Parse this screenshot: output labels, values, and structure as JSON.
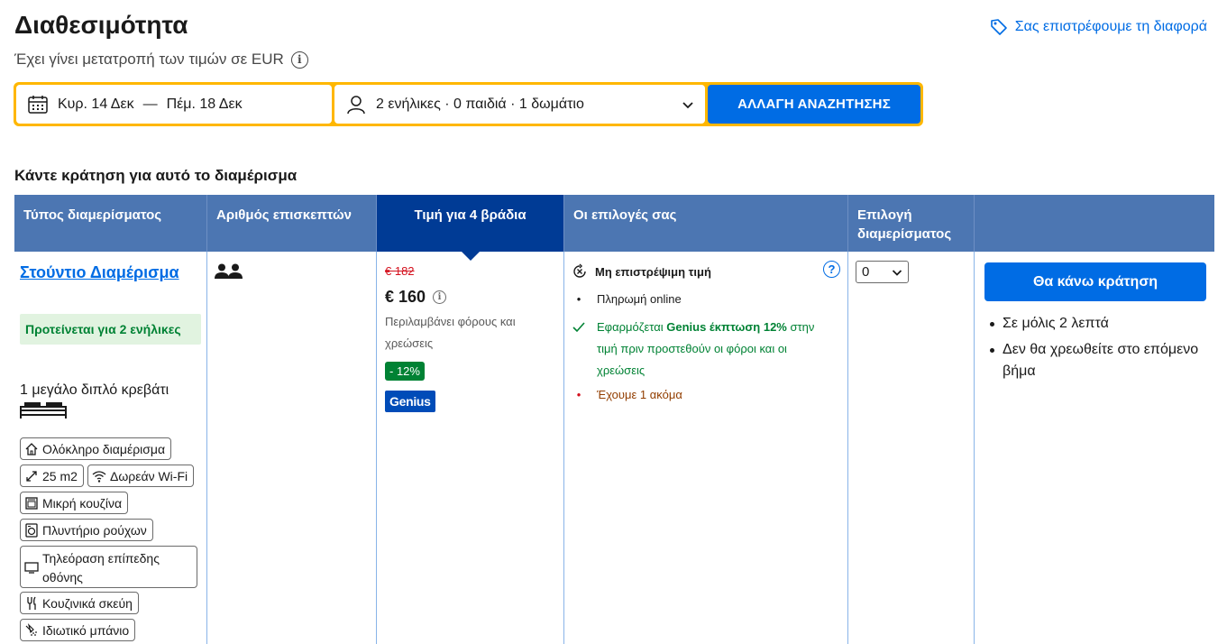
{
  "header": {
    "title": "Διαθεσιμότητα",
    "subtitle": "Έχει γίνει μετατροπή των τιμών σε EUR",
    "price_match": "Σας επιστρέφουμε τη διαφορά"
  },
  "search": {
    "checkin": "Κυρ. 14 Δεκ",
    "separator": "—",
    "checkout": "Πέμ. 18 Δεκ",
    "guests": "2 ενήλικες · 0 παιδιά · 1 δωμάτιο",
    "button": "ΑΛΛΑΓΗ ΑΝΑΖΗΤΗΣΗΣ"
  },
  "booking_heading": "Κάντε κράτηση για αυτό το διαμέρισμα",
  "columns": [
    "Τύπος διαμερίσματος",
    "Αριθμός επισκεπτών",
    "Τιμή για 4 βράδια",
    "Οι επιλογές σας",
    "Επιλογή διαμερίσματος"
  ],
  "room": {
    "name": "Στούντιο Διαμέρισμα",
    "recommended": "Προτείνεται για 2 ενήλικες",
    "bed": "1 μεγάλο διπλό κρεβάτι",
    "amenities": {
      "entire": "Ολόκληρο διαμέρισμα",
      "size": "25 m2",
      "wifi": "Δωρεάν Wi-Fi",
      "kitchenette": "Μικρή κουζίνα",
      "washer": "Πλυντήριο ρούχων",
      "tv": "Τηλεόραση επίπεδης οθόνης",
      "kitchenware": "Κουζινικά σκεύη",
      "bathroom": "Ιδιωτικό μπάνιο"
    }
  },
  "price": {
    "old": "€ 182",
    "current": "€ 160",
    "includes": "Περιλαμβάνει φόρους και χρεώσεις",
    "discount": "- 12%",
    "badge": "Genius"
  },
  "options": {
    "title": "Μη επιστρέψιμη τιμή",
    "help": "?",
    "payment": "Πληρωμή online",
    "genius_prefix": "Εφαρμόζεται ",
    "genius_bold": "Genius έκπτωση 12%",
    "genius_suffix": " στην τιμή πριν προστεθούν οι φόροι και οι χρεώσεις",
    "remaining": "Έχουμε 1 ακόμα"
  },
  "select": {
    "value": "0"
  },
  "reserve": {
    "button": "Θα κάνω κράτηση",
    "notes": [
      "Σε μόλις 2 λεπτά",
      "Δεν θα χρεωθείτε στο επόμενο βήμα"
    ]
  },
  "colors": {
    "primary": "#006ce4",
    "header_bg": "#4c76b2",
    "header_highlight": "#003b95",
    "search_border": "#ffb700",
    "green": "#008234",
    "red": "#d4111e"
  }
}
